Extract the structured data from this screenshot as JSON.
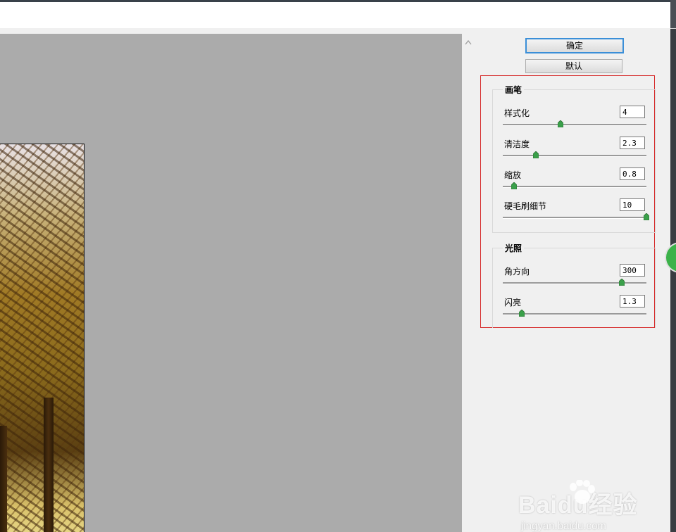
{
  "buttons": {
    "ok_label": "确定",
    "default_label": "默认"
  },
  "brush": {
    "title": "画笔",
    "params": [
      {
        "label": "样式化",
        "value": "4",
        "level": 0.4
      },
      {
        "label": "清洁度",
        "value": "2.3",
        "level": 0.23
      },
      {
        "label": "缩放",
        "value": "0.8",
        "level": 0.08
      },
      {
        "label": "硬毛刷细节",
        "value": "10",
        "level": 1.0
      }
    ]
  },
  "lighting": {
    "title": "光照",
    "params": [
      {
        "label": "角方向",
        "value": "300",
        "level": 0.83
      },
      {
        "label": "闪亮",
        "value": "1.3",
        "level": 0.13
      }
    ]
  },
  "watermark": {
    "logo": "Baidu经验",
    "url": "jingyan.baidu.com"
  },
  "colors": {
    "highlight_border": "#d62b2b",
    "primary_button_border": "#3b8fd8",
    "preview_background": "#ababab"
  },
  "icons": {
    "scroll_up": "chevron-up-icon",
    "slider_thumb": "slider-thumb-icon"
  }
}
